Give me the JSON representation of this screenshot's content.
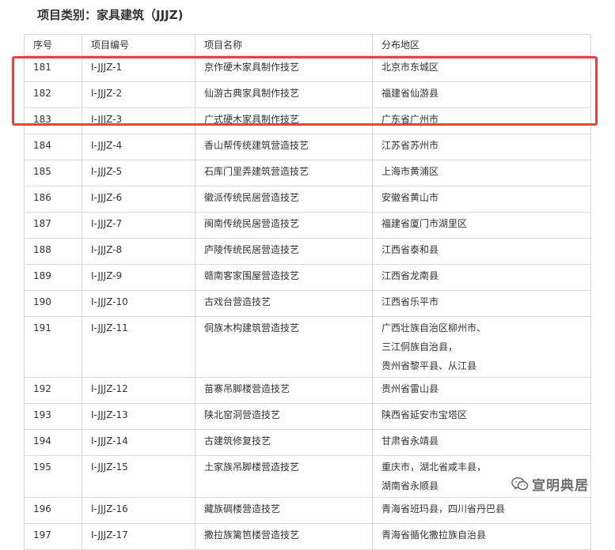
{
  "heading": "项目类别：家具建筑（JJJZ)",
  "columns": [
    "序号",
    "项目编号",
    "项目名称",
    "分布地区"
  ],
  "rows": [
    {
      "no": "181",
      "code": "Ⅰ-JJJZ-1",
      "name": "京作硬木家具制作技艺",
      "region": [
        "北京市东城区"
      ]
    },
    {
      "no": "182",
      "code": "Ⅰ-JJJZ-2",
      "name": "仙游古典家具制作技艺",
      "region": [
        "福建省仙游县"
      ]
    },
    {
      "no": "183",
      "code": "Ⅰ-JJJZ-3",
      "name": "广式硬木家具制作技艺",
      "region": [
        "广东省广州市"
      ]
    },
    {
      "no": "184",
      "code": "Ⅰ-JJJZ-4",
      "name": "香山帮传统建筑营造技艺",
      "region": [
        "江苏省苏州市"
      ]
    },
    {
      "no": "185",
      "code": "Ⅰ-JJJZ-5",
      "name": "石库门里弄建筑营造技艺",
      "region": [
        "上海市黄浦区"
      ]
    },
    {
      "no": "186",
      "code": "Ⅰ-JJJZ-6",
      "name": "徽派传统民居营造技艺",
      "region": [
        "安徽省黄山市"
      ]
    },
    {
      "no": "187",
      "code": "Ⅰ-JJJZ-7",
      "name": "闽南传统民居营造技艺",
      "region": [
        "福建省厦门市湖里区"
      ]
    },
    {
      "no": "188",
      "code": "Ⅰ-JJJZ-8",
      "name": "庐陵传统民居营造技艺",
      "region": [
        "江西省泰和县"
      ]
    },
    {
      "no": "189",
      "code": "Ⅰ-JJJZ-9",
      "name": "赣南客家围屋营造技艺",
      "region": [
        "江西省龙南县"
      ]
    },
    {
      "no": "190",
      "code": "Ⅰ-JJJZ-10",
      "name": "古戏台营造技艺",
      "region": [
        "江西省乐平市"
      ]
    },
    {
      "no": "191",
      "code": "Ⅰ-JJJZ-11",
      "name": "侗族木构建筑营造技艺",
      "region": [
        "广西壮族自治区柳州市、",
        "三江侗族自治县，",
        "贵州省黎平县、从江县"
      ]
    },
    {
      "no": "192",
      "code": "Ⅰ-JJJZ-12",
      "name": "苗寨吊脚楼营造技艺",
      "region": [
        "贵州省雷山县"
      ]
    },
    {
      "no": "193",
      "code": "Ⅰ-JJJZ-13",
      "name": "陕北窑洞营造技艺",
      "region": [
        "陕西省延安市宝塔区"
      ]
    },
    {
      "no": "194",
      "code": "Ⅰ-JJJZ-14",
      "name": "古建筑修复技艺",
      "region": [
        "甘肃省永靖县"
      ]
    },
    {
      "no": "195",
      "code": "Ⅰ-JJJZ-15",
      "name": "土家族吊脚楼营造技艺",
      "region": [
        "重庆市，湖北省咸丰县，",
        "湖南省永顺县"
      ]
    },
    {
      "no": "196",
      "code": "Ⅰ-JJJZ-16",
      "name": "藏族碉楼营造技艺",
      "region": [
        "青海省班玛县，四川省丹巴县"
      ]
    },
    {
      "no": "197",
      "code": "Ⅰ-JJJZ-17",
      "name": "撒拉族篱笆楼营造技艺",
      "region": [
        "青海省循化撒拉族自治县"
      ]
    }
  ],
  "watermark": {
    "text": "宣明典居",
    "icon": "wechat-icon"
  },
  "colors": {
    "highlight": "#e8413f",
    "border": "#d9d9d9",
    "text": "#333333"
  }
}
